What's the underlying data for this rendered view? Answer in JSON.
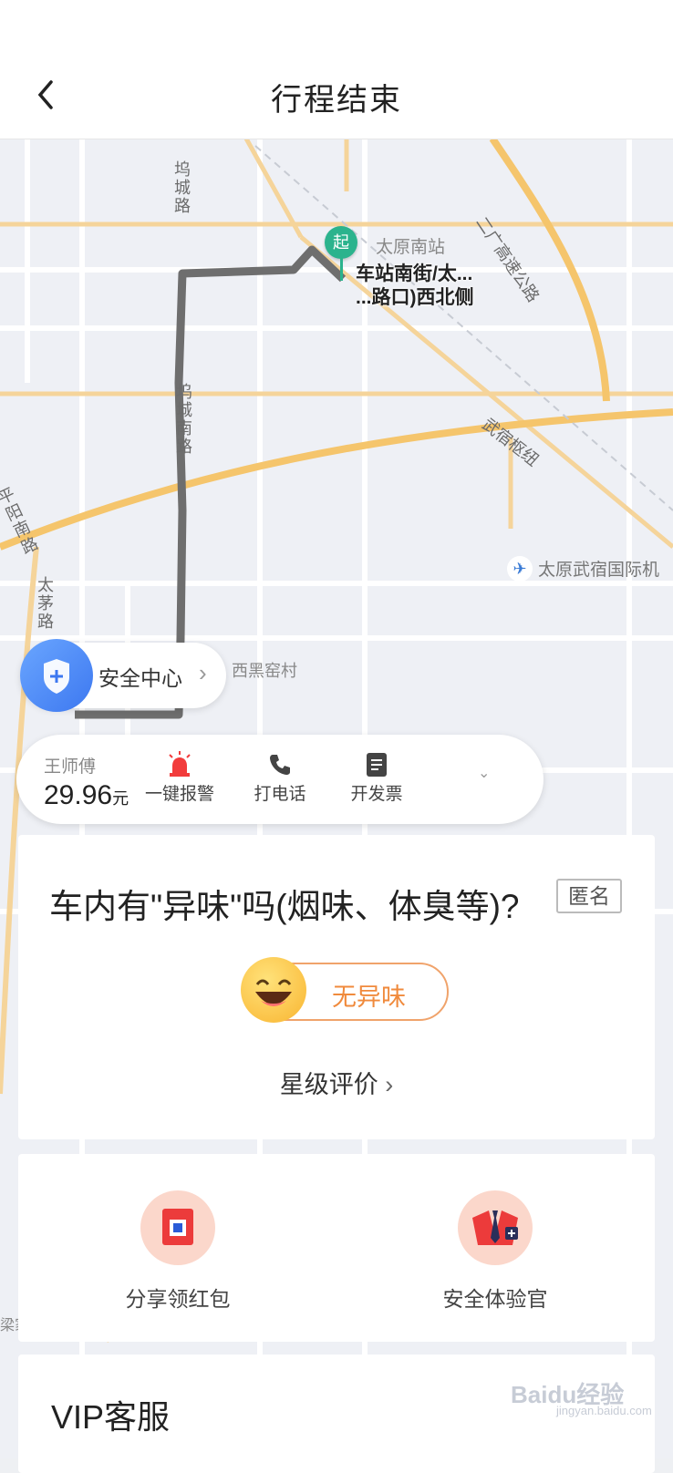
{
  "header": {
    "title": "行程结束",
    "back_icon": "chevron-left-icon"
  },
  "map": {
    "labels": {
      "wucheng_road": "坞城路",
      "wucheng_south_road": "坞城南路",
      "expressway": "二广高速公路",
      "wusu_hub": "武宿枢纽",
      "pingyang_south_road": "平阳南路",
      "taimao_road": "太茅路",
      "taiyuan_south_station": "太原南站",
      "airport": "太原武宿国际机",
      "village": "西黑窑村",
      "liangjia": "梁家庄村"
    },
    "start_pin": {
      "badge": "起",
      "line1": "车站南街/太...",
      "line2": "...路口)西北侧"
    }
  },
  "safety_center": {
    "label": "安全中心"
  },
  "trip_bar": {
    "driver": "王师傅",
    "price": "29.96",
    "currency": "元",
    "actions": [
      {
        "label": "一键报警",
        "icon": "alarm-icon"
      },
      {
        "label": "打电话",
        "icon": "phone-icon"
      },
      {
        "label": "开发票",
        "icon": "invoice-icon"
      }
    ]
  },
  "survey": {
    "question": "车内有\"异味\"吗(烟味、体臭等)?",
    "anonymous": "匿名",
    "answer": "无异味",
    "star_rating": "星级评价"
  },
  "promos": [
    {
      "label": "分享领红包",
      "icon": "red-envelope-icon"
    },
    {
      "label": "安全体验官",
      "icon": "safety-officer-icon"
    }
  ],
  "vip": {
    "title": "VIP客服"
  },
  "watermark": {
    "brand": "Baidu经验",
    "url": "jingyan.baidu.com"
  },
  "colors": {
    "accent_green": "#2bb38d",
    "route_gray": "#6e6e6e",
    "accent_orange": "#f08a3c",
    "safety_blue": "#3d78f0",
    "alarm_red": "#f23c3c"
  }
}
